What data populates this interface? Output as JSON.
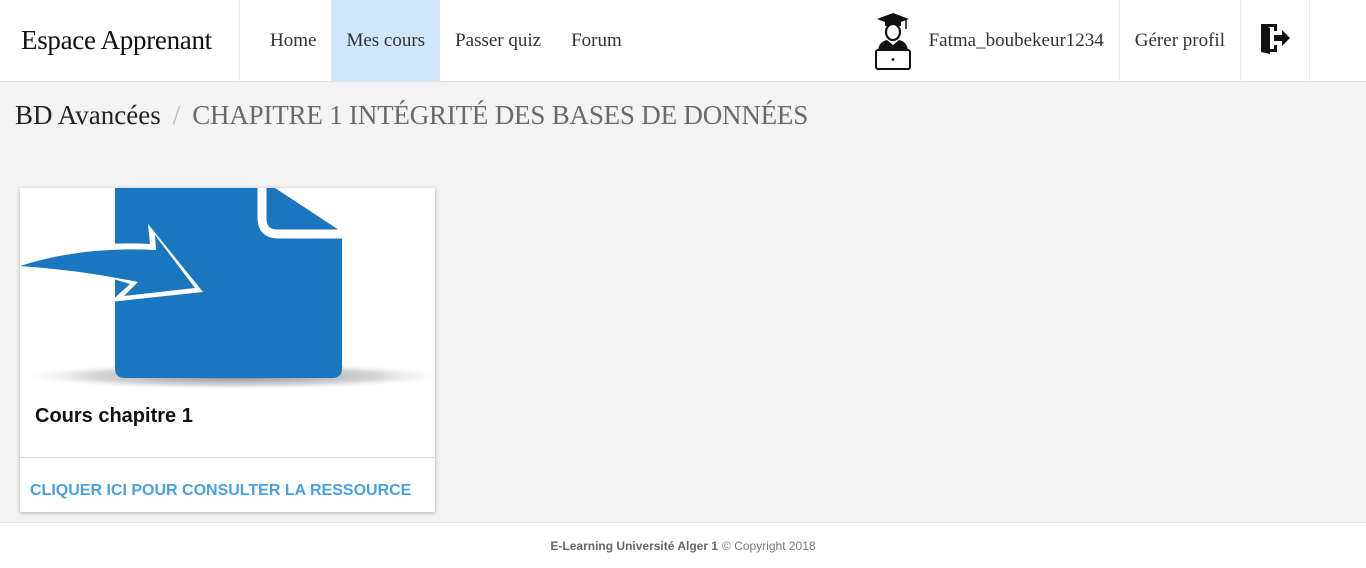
{
  "app": {
    "brand": "Espace Apprenant"
  },
  "nav": {
    "items": [
      {
        "label": "Home",
        "active": false
      },
      {
        "label": "Mes cours",
        "active": true
      },
      {
        "label": "Passer quiz",
        "active": false
      },
      {
        "label": "Forum",
        "active": false
      }
    ],
    "user": {
      "avatar_icon": "graduate-student-laptop-icon",
      "name": "Fatma_boubekeur1234"
    },
    "profile_label": "Gérer profil",
    "logout_icon": "logout-door-icon",
    "active_color": "#cfe6fb"
  },
  "breadcrumb": {
    "course": "BD Avancées",
    "separator": "/",
    "current": "CHAPITRE 1 INTÉGRITÉ DES BASES DE DONNÉES"
  },
  "resources": [
    {
      "media_icon": "file-import-arrow-icon",
      "title": "Cours chapitre 1",
      "action_label": "CLIQUER ICI POUR CONSULTER LA RESSOURCE",
      "accent_color": "#1a76bf",
      "action_color": "#4aa0e6"
    }
  ],
  "footer": {
    "org": "E-Learning Université Alger 1",
    "copyright": "© Copyright 2018"
  }
}
